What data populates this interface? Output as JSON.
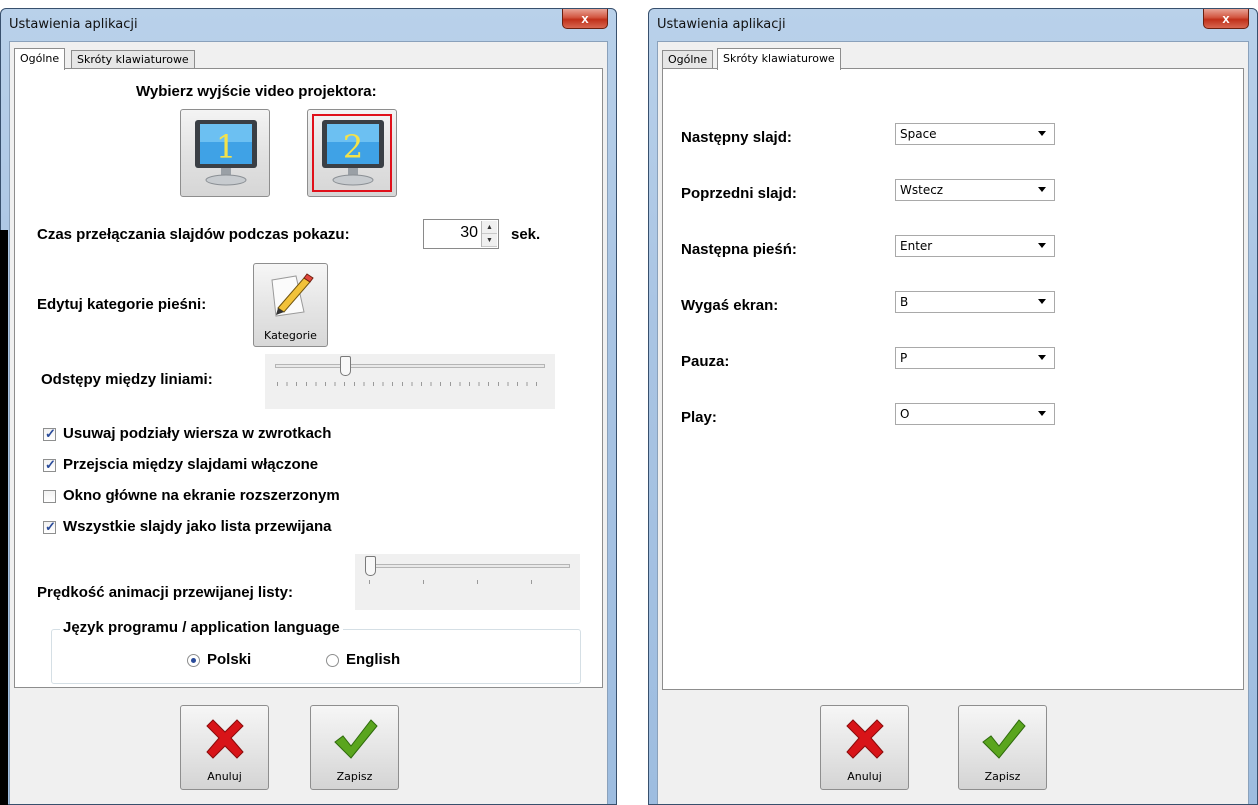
{
  "general_window": {
    "title": "Ustawienia aplikacji",
    "close_label": "x",
    "tabs": [
      {
        "label": "Ogólne",
        "active": true
      },
      {
        "label": "Skróty klawiaturowe",
        "active": false
      }
    ],
    "projector": {
      "heading": "Wybierz wyjście video projektora:",
      "options": [
        {
          "label": "1",
          "selected": false
        },
        {
          "label": "2",
          "selected": true
        }
      ]
    },
    "slide_time": {
      "label": "Czas przełączania slajdów podczas pokazu:",
      "value": "30",
      "unit": "sek."
    },
    "categories": {
      "label": "Edytuj kategorie pieśni:",
      "button_label": "Kategorie"
    },
    "line_spacing": {
      "label": "Odstępy między liniami:",
      "position": 0.25
    },
    "checkboxes": [
      {
        "label": "Usuwaj podziały wiersza w zwrotkach",
        "checked": true
      },
      {
        "label": "Przejscia między slajdami włączone",
        "checked": true
      },
      {
        "label": "Okno główne na ekranie rozszerzonym",
        "checked": false
      },
      {
        "label": "Wszystkie slajdy jako lista przewijana",
        "checked": true
      }
    ],
    "animation_speed": {
      "label": "Prędkość animacji przewijanej listy:",
      "position": 0.0
    },
    "language": {
      "legend": "Język programu / application language",
      "options": [
        {
          "label": "Polski",
          "selected": true
        },
        {
          "label": "English",
          "selected": false
        }
      ]
    },
    "cancel_label": "Anuluj",
    "save_label": "Zapisz"
  },
  "shortcuts_window": {
    "title": "Ustawienia aplikacji",
    "close_label": "x",
    "tabs": [
      {
        "label": "Ogólne",
        "active": false
      },
      {
        "label": "Skróty klawiaturowe",
        "active": true
      }
    ],
    "shortcuts": [
      {
        "label": "Następny slajd:",
        "value": "Space"
      },
      {
        "label": "Poprzedni slajd:",
        "value": "Wstecz"
      },
      {
        "label": "Następna pieśń:",
        "value": "Enter"
      },
      {
        "label": "Wygaś ekran:",
        "value": "B"
      },
      {
        "label": "Pauza:",
        "value": "P"
      },
      {
        "label": "Play:",
        "value": "O"
      }
    ],
    "cancel_label": "Anuluj",
    "save_label": "Zapisz"
  },
  "colors": {
    "accent_check": "#2a4b9a",
    "selection_red": "#e0101a",
    "cancel_red": "#d81418",
    "save_green": "#5aa51e"
  }
}
